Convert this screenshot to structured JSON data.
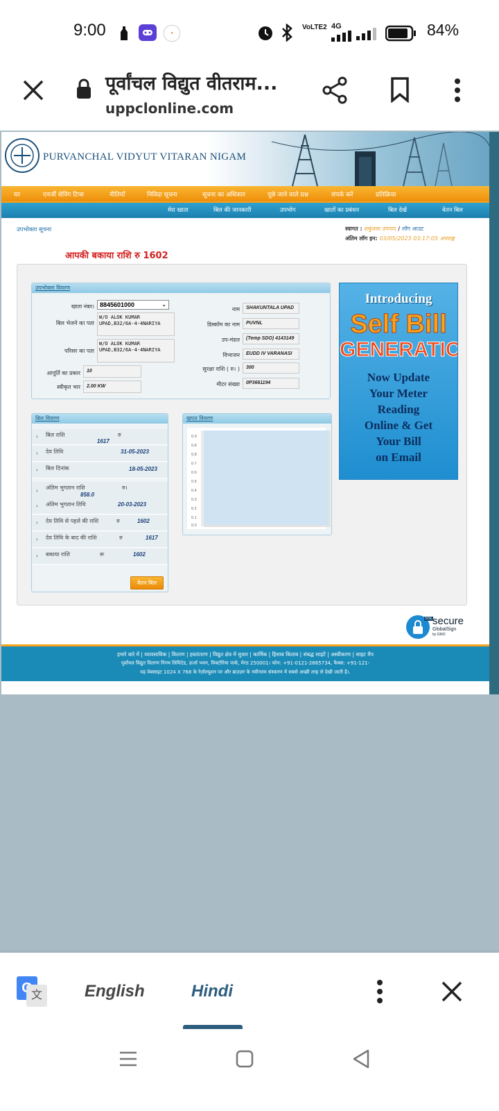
{
  "status_bar": {
    "time": "9:00",
    "net_speed": "VoLTE2",
    "net_type": "4G",
    "battery": "84%"
  },
  "browser": {
    "page_title": "पूर्वांचल विद्युत वीतराम...",
    "url": "uppclonline.com"
  },
  "site": {
    "brand": "Purvanchal Vidyut Vitaran Nigam",
    "main_nav": [
      "घर",
      "एनर्जी सेविंग टिप्स",
      "नीतियाँ",
      "निविदा सूचना",
      "सूचना का अधिकार",
      "पूछे जाने वाले प्रश्न",
      "संपर्क करें",
      "प्रतिक्रिया"
    ],
    "sub_nav": [
      "मेरा खाता",
      "बिल की जानकारी",
      "उपभोग",
      "खातों का प्रबंधन",
      "बिल देखें",
      "वेतन बिल"
    ],
    "section_label": "उपभोक्ता सूचना",
    "welcome_label": "स्वागत :",
    "welcome_user": "शकुंतला उपपाद",
    "logout": "लॉग आउट",
    "last_login_label": "अंतिम लॉग इन:",
    "last_login_value": "03/05/2023 03:17:05 अपराह्न",
    "due_amount_text": "आपकी बकाया राशि रु 1602",
    "consumer_panel": {
      "title": "उपभोक्ता विवरण",
      "account_label": "खाता नंबर।",
      "account_number": "8845601000",
      "billing_address_label": "बिल भेजने का पता",
      "billing_address": "W/O ALOK KUMAR UPAD,B32/6A-4-4NARIYA",
      "premises_address_label": "परिसर का पता",
      "premises_address": "W/O ALOK KUMAR UPAD,B32/6A-4-4NARIYA",
      "supply_type_label": "आपूर्ति का प्रकार",
      "supply_type": "10",
      "sanctioned_load_label": "स्वीकृत भार",
      "sanctioned_load": "2.00 KW",
      "name_label": "नाम",
      "name": "SHAKUNTALA UPAD",
      "discom_label": "डिस्कॉम का नाम",
      "discom": "PUVNL",
      "subdivision_label": "उप-मंडल",
      "subdivision": "(Temp SDO) 4143149",
      "division_label": "विभाजन",
      "division": "EUDD IV VARANASI",
      "security_label": "सुरक्षा राशि ( रु। )",
      "security_amount": "300",
      "meter_label": "मीटर संख्या",
      "meter_number": "0P3661194"
    },
    "bill_panel": {
      "title": "बिल विवरण",
      "rows": [
        {
          "label": "बिल राशि",
          "prefix": "रु",
          "value": "1617"
        },
        {
          "label": "देय तिथि",
          "prefix": "",
          "value": "31-05-2023"
        },
        {
          "label": "बिल दिनांक",
          "prefix": "",
          "value": "18-05-2023"
        },
        {
          "label": "अंतिम भुगतान राशि",
          "prefix": "रु।",
          "value": "858.0"
        },
        {
          "label": "अंतिम भुगतान तिथि",
          "prefix": "",
          "value": "20-03-2023"
        },
        {
          "label": "देय तिथि से पहले की राशि",
          "prefix": "रु",
          "value": "1602"
        },
        {
          "label": "देय तिथि के बाद की राशि",
          "prefix": "रु",
          "value": "1617"
        },
        {
          "label": "बकाया राशि",
          "prefix": "रू",
          "value": "1602"
        }
      ],
      "pay_button": "वेतन बिल"
    },
    "consumption_panel": {
      "title": "खपत विवरण",
      "y_ticks": [
        "0.9",
        "0.8",
        "0.8",
        "0.7",
        "0.6",
        "0.5",
        "0.4",
        "0.3",
        "0.2",
        "0.1",
        "0.0"
      ]
    },
    "ad": {
      "line1": "Introducing",
      "line2": "Self Bill",
      "line3": "GENERATION",
      "body": [
        "Now Update",
        "Your Meter",
        "Reading",
        "Online & Get",
        "Your Bill",
        "on Email"
      ]
    },
    "ssl": {
      "main": "secure",
      "sub": "GlobalSign",
      "tiny": "by GMO",
      "badge": "SSL"
    },
    "footer": {
      "links": "हमारे बारे में | व्यावसायिक | वितरण | हस्तांतरण | विद्युत क्षेत्र में सुधार | कार्मिक | हिसाब किताब | संबद्ध साइटें | अस्वीकरण | साइट मैप",
      "address": "पूर्वांचल विद्युत वितरण निगम लिमिटेड, ऊर्जा भवन, विक्टोरिया पार्क, मेरठ 250001। फोन: +91-0121-2665734, फैक्स: +91-121-",
      "note": "यह वेबसाइट 1024 X 768 के रेज़ोल्यूशन पर और ब्राउज़र के नवीनतम संस्करण में सबसे अच्छी तरह से देखी जाती है।."
    }
  },
  "translate_bar": {
    "lang_from": "English",
    "lang_to": "Hindi"
  }
}
